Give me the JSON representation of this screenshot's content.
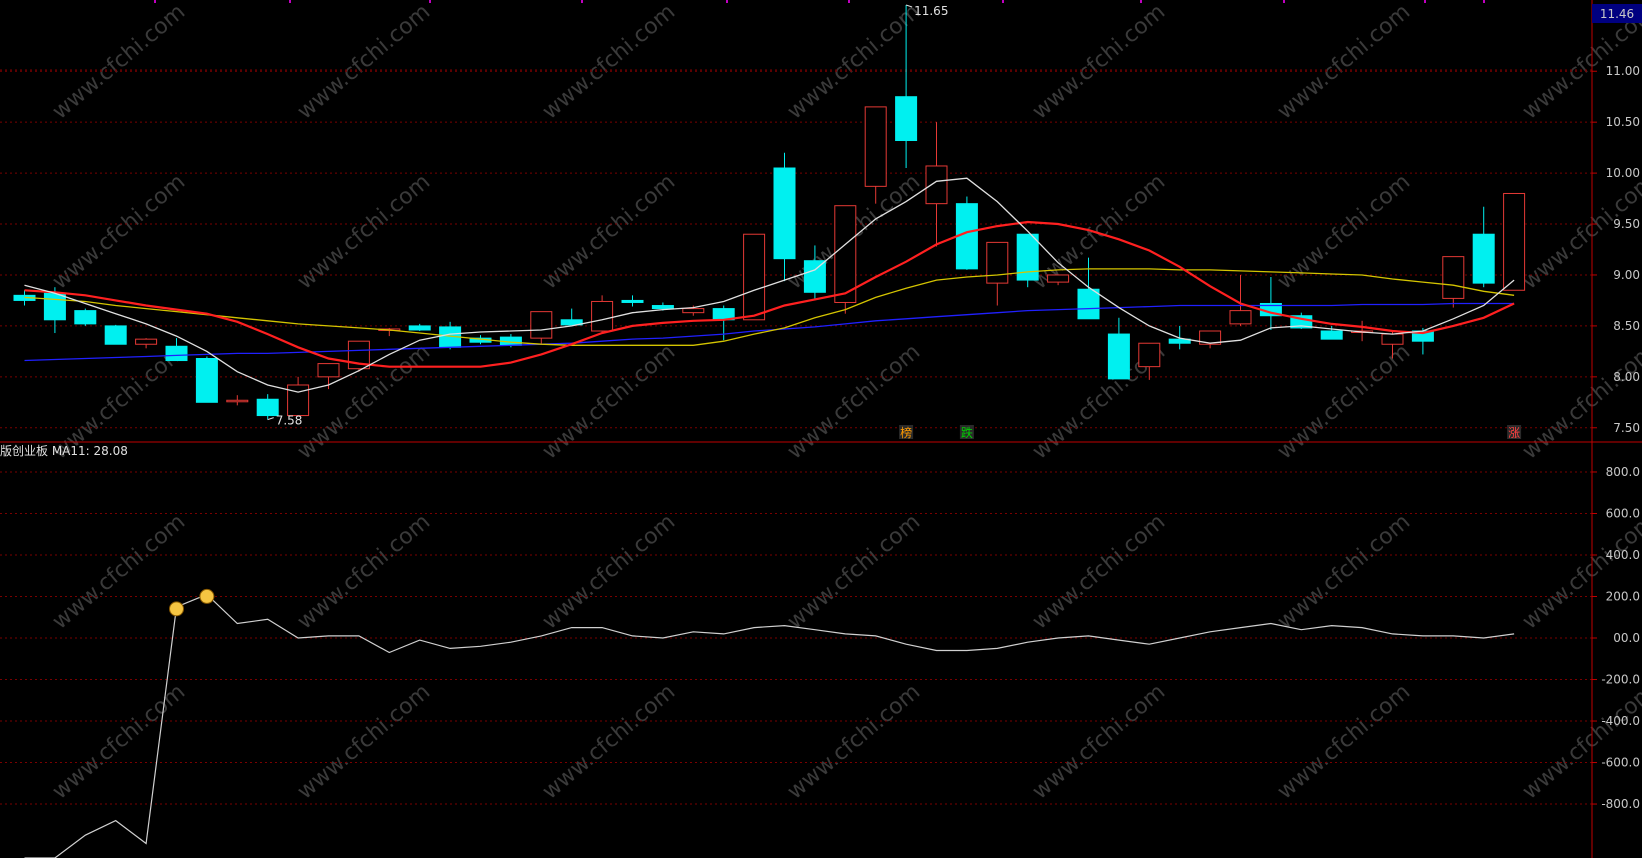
{
  "colors": {
    "background": "#000000",
    "up": "#e53935",
    "down": "#00f0f0",
    "grid": "#7a0000",
    "axis": "#c00000",
    "ma_fast": "#e0e0e0",
    "ma_mid": "#ff2020",
    "ma_slow": "#d4c400",
    "ma_long": "#2020ff",
    "indicator": "#d0d0d0",
    "marker_purple": "#c000c0",
    "price_box": "#000080"
  },
  "price_axis": {
    "ticks": [
      "11.00",
      "10.50",
      "10.00",
      "9.50",
      "9.00",
      "8.50",
      "8.00",
      "7.50"
    ],
    "current_label": "11.46"
  },
  "indicator_axis": {
    "ticks": [
      "800.0",
      "600.0",
      "400.0",
      "200.0",
      "00.0",
      "-200.0",
      "-400.0",
      "-600.0",
      "-800.0"
    ]
  },
  "indicator_title": "版创业板  MA11: 28.08",
  "annotations": {
    "high_label": "11.65",
    "low_label": "7.58",
    "event_labels": [
      {
        "text": "榜",
        "color": "#ff9a00"
      },
      {
        "text": "跌",
        "color": "#00d000"
      },
      {
        "text": "涨",
        "color": "#ff4040"
      }
    ]
  },
  "watermark": "www.cfchi.com",
  "chart_data": [
    {
      "type": "candlestick",
      "y_range": [
        7.38,
        11.66
      ],
      "candles": [
        {
          "o": 8.8,
          "h": 8.85,
          "l": 8.7,
          "c": 8.75
        },
        {
          "o": 8.82,
          "h": 8.88,
          "l": 8.43,
          "c": 8.56
        },
        {
          "o": 8.65,
          "h": 8.67,
          "l": 8.5,
          "c": 8.52
        },
        {
          "o": 8.5,
          "h": 8.51,
          "l": 8.32,
          "c": 8.32
        },
        {
          "o": 8.32,
          "h": 8.38,
          "l": 8.28,
          "c": 8.37
        },
        {
          "o": 8.3,
          "h": 8.38,
          "l": 8.16,
          "c": 8.16
        },
        {
          "o": 8.18,
          "h": 8.2,
          "l": 7.75,
          "c": 7.75
        },
        {
          "o": 7.77,
          "h": 7.82,
          "l": 7.72,
          "c": 7.77
        },
        {
          "o": 7.78,
          "h": 7.83,
          "l": 7.58,
          "c": 7.62
        },
        {
          "o": 7.62,
          "h": 8.0,
          "l": 7.62,
          "c": 7.92
        },
        {
          "o": 8.0,
          "h": 8.13,
          "l": 7.88,
          "c": 8.13
        },
        {
          "o": 8.08,
          "h": 8.35,
          "l": 8.05,
          "c": 8.35
        },
        {
          "o": 8.46,
          "h": 8.48,
          "l": 8.4,
          "c": 8.47
        },
        {
          "o": 8.5,
          "h": 8.52,
          "l": 8.45,
          "c": 8.46
        },
        {
          "o": 8.49,
          "h": 8.54,
          "l": 8.27,
          "c": 8.29
        },
        {
          "o": 8.38,
          "h": 8.41,
          "l": 8.32,
          "c": 8.34
        },
        {
          "o": 8.39,
          "h": 8.42,
          "l": 8.29,
          "c": 8.31
        },
        {
          "o": 8.38,
          "h": 8.64,
          "l": 8.32,
          "c": 8.64
        },
        {
          "o": 8.56,
          "h": 8.67,
          "l": 8.51,
          "c": 8.51
        },
        {
          "o": 8.45,
          "h": 8.8,
          "l": 8.44,
          "c": 8.74
        },
        {
          "o": 8.75,
          "h": 8.8,
          "l": 8.69,
          "c": 8.73
        },
        {
          "o": 8.7,
          "h": 8.73,
          "l": 8.65,
          "c": 8.67
        },
        {
          "o": 8.63,
          "h": 8.7,
          "l": 8.6,
          "c": 8.67
        },
        {
          "o": 8.67,
          "h": 8.7,
          "l": 8.36,
          "c": 8.56
        },
        {
          "o": 8.56,
          "h": 9.4,
          "l": 8.56,
          "c": 9.4
        },
        {
          "o": 10.05,
          "h": 10.2,
          "l": 8.94,
          "c": 9.16
        },
        {
          "o": 9.14,
          "h": 9.29,
          "l": 8.75,
          "c": 8.83
        },
        {
          "o": 8.73,
          "h": 9.68,
          "l": 8.62,
          "c": 9.68
        },
        {
          "o": 9.87,
          "h": 10.65,
          "l": 9.7,
          "c": 10.65
        },
        {
          "o": 10.75,
          "h": 11.65,
          "l": 10.05,
          "c": 10.32
        },
        {
          "o": 9.7,
          "h": 10.5,
          "l": 9.28,
          "c": 10.07
        },
        {
          "o": 9.7,
          "h": 9.77,
          "l": 9.05,
          "c": 9.06
        },
        {
          "o": 8.92,
          "h": 9.32,
          "l": 8.7,
          "c": 9.32
        },
        {
          "o": 9.4,
          "h": 9.4,
          "l": 8.88,
          "c": 8.95
        },
        {
          "o": 8.93,
          "h": 9.0,
          "l": 8.9,
          "c": 9.0
        },
        {
          "o": 8.86,
          "h": 9.17,
          "l": 8.57,
          "c": 8.57
        },
        {
          "o": 8.42,
          "h": 8.58,
          "l": 7.98,
          "c": 7.98
        },
        {
          "o": 8.1,
          "h": 8.33,
          "l": 7.97,
          "c": 8.33
        },
        {
          "o": 8.37,
          "h": 8.5,
          "l": 8.27,
          "c": 8.33
        },
        {
          "o": 8.32,
          "h": 8.45,
          "l": 8.28,
          "c": 8.45
        },
        {
          "o": 8.52,
          "h": 9.0,
          "l": 8.5,
          "c": 8.65
        },
        {
          "o": 8.72,
          "h": 8.98,
          "l": 8.46,
          "c": 8.6
        },
        {
          "o": 8.6,
          "h": 8.63,
          "l": 8.47,
          "c": 8.48
        },
        {
          "o": 8.45,
          "h": 8.5,
          "l": 8.37,
          "c": 8.37
        },
        {
          "o": 8.44,
          "h": 8.55,
          "l": 8.35,
          "c": 8.45
        },
        {
          "o": 8.32,
          "h": 8.45,
          "l": 8.18,
          "c": 8.42
        },
        {
          "o": 8.45,
          "h": 8.48,
          "l": 8.22,
          "c": 8.35
        },
        {
          "o": 8.77,
          "h": 9.18,
          "l": 8.68,
          "c": 9.18
        },
        {
          "o": 9.4,
          "h": 9.67,
          "l": 8.88,
          "c": 8.92
        },
        {
          "o": 8.85,
          "h": 9.8,
          "l": 8.85,
          "c": 9.8
        }
      ],
      "ma_fast": [
        8.9,
        8.82,
        8.72,
        8.62,
        8.52,
        8.4,
        8.25,
        8.05,
        7.92,
        7.85,
        7.92,
        8.06,
        8.22,
        8.36,
        8.42,
        8.44,
        8.45,
        8.46,
        8.5,
        8.56,
        8.63,
        8.66,
        8.68,
        8.74,
        8.85,
        8.95,
        9.05,
        9.3,
        9.55,
        9.72,
        9.92,
        9.95,
        9.72,
        9.43,
        9.12,
        8.88,
        8.68,
        8.5,
        8.38,
        8.33,
        8.36,
        8.48,
        8.5,
        8.47,
        8.44,
        8.42,
        8.45,
        8.57,
        8.7,
        8.95
      ],
      "ma_mid": [
        8.85,
        8.83,
        8.8,
        8.75,
        8.7,
        8.66,
        8.62,
        8.54,
        8.42,
        8.29,
        8.18,
        8.13,
        8.1,
        8.1,
        8.1,
        8.1,
        8.14,
        8.22,
        8.32,
        8.43,
        8.5,
        8.53,
        8.55,
        8.56,
        8.6,
        8.7,
        8.76,
        8.82,
        8.98,
        9.13,
        9.3,
        9.42,
        9.48,
        9.52,
        9.5,
        9.44,
        9.35,
        9.24,
        9.08,
        8.89,
        8.72,
        8.63,
        8.57,
        8.52,
        8.49,
        8.45,
        8.43,
        8.5,
        8.58,
        8.72
      ],
      "ma_slow": [
        8.78,
        8.76,
        8.74,
        8.7,
        8.67,
        8.64,
        8.61,
        8.58,
        8.55,
        8.52,
        8.5,
        8.48,
        8.46,
        8.43,
        8.4,
        8.37,
        8.34,
        8.32,
        8.31,
        8.31,
        8.31,
        8.31,
        8.31,
        8.35,
        8.42,
        8.48,
        8.58,
        8.66,
        8.78,
        8.87,
        8.95,
        8.98,
        9.0,
        9.03,
        9.05,
        9.06,
        9.06,
        9.06,
        9.05,
        9.05,
        9.04,
        9.03,
        9.02,
        9.01,
        9.0,
        8.96,
        8.93,
        8.9,
        8.84,
        8.8
      ],
      "ma_long": [
        8.16,
        8.17,
        8.18,
        8.19,
        8.2,
        8.21,
        8.22,
        8.23,
        8.23,
        8.24,
        8.25,
        8.26,
        8.27,
        8.28,
        8.29,
        8.3,
        8.31,
        8.32,
        8.33,
        8.35,
        8.37,
        8.38,
        8.4,
        8.42,
        8.45,
        8.47,
        8.49,
        8.52,
        8.55,
        8.57,
        8.59,
        8.61,
        8.63,
        8.65,
        8.66,
        8.67,
        8.68,
        8.69,
        8.7,
        8.7,
        8.7,
        8.7,
        8.7,
        8.7,
        8.71,
        8.71,
        8.71,
        8.72,
        8.72,
        8.72
      ]
    },
    {
      "type": "line",
      "y_range": [
        -1060,
        930
      ],
      "values": [
        -1060,
        -1060,
        -950,
        -880,
        -990,
        150,
        210,
        70,
        90,
        0,
        10,
        10,
        -70,
        -10,
        -50,
        -40,
        -20,
        10,
        50,
        50,
        10,
        0,
        30,
        20,
        50,
        60,
        40,
        20,
        10,
        -30,
        -60,
        -60,
        -50,
        -20,
        0,
        10,
        -10,
        -30,
        0,
        30,
        50,
        70,
        40,
        60,
        50,
        20,
        10,
        10,
        0,
        20
      ],
      "marker_indices": [
        5,
        6
      ]
    }
  ]
}
